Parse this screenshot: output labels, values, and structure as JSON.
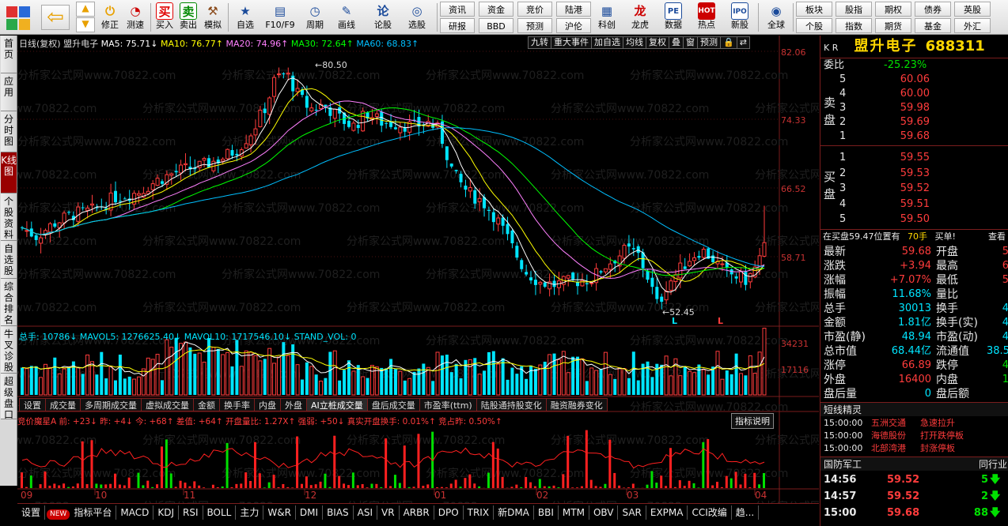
{
  "toolbar": {
    "buttons": [
      {
        "label": "买入",
        "icon": "买",
        "color": "#e00000"
      },
      {
        "label": "卖出",
        "icon": "卖",
        "color": "#008800"
      },
      {
        "label": "模拟",
        "icon": "🔨",
        "color": "#8a4a1a"
      },
      {
        "label": "自选",
        "icon": "★",
        "color": "#1a4a9a"
      },
      {
        "label": "F10/F9",
        "icon": "▤",
        "color": "#1a4a9a"
      },
      {
        "label": "周期",
        "icon": "◷",
        "color": "#1a4a9a"
      },
      {
        "label": "画线",
        "icon": "✎",
        "color": "#1a4a9a"
      },
      {
        "label": "论股",
        "icon": "论",
        "color": "#1a4a9a"
      },
      {
        "label": "选股",
        "icon": "◎",
        "color": "#1a4a9a"
      },
      {
        "label": "科创",
        "icon": "▦",
        "color": "#1a4a9a"
      },
      {
        "label": "龙虎",
        "icon": "龙",
        "color": "#c00000"
      },
      {
        "label": "数据",
        "icon": "PE",
        "color": "#1a4a9a"
      },
      {
        "label": "热点",
        "icon": "HOT",
        "color": "#c00000"
      },
      {
        "label": "新股",
        "icon": "IPO",
        "color": "#1a4a9a"
      },
      {
        "label": "全球",
        "icon": "◉",
        "color": "#1a4a9a"
      }
    ],
    "small_buttons": [
      {
        "label": "修正",
        "icon": "↑"
      },
      {
        "label": "测速",
        "icon": "⏻"
      },
      {
        "label": "测速",
        "icon": "◔"
      }
    ],
    "grid1": [
      [
        "资讯",
        "资金",
        "竞价",
        "陆港"
      ],
      [
        "研报",
        "BBD",
        "预测",
        "沪伦"
      ]
    ],
    "grid2": [
      [
        "板块",
        "股指",
        "期权",
        "债券",
        "英股"
      ],
      [
        "个股",
        "指数",
        "期货",
        "基金",
        "外汇"
      ]
    ]
  },
  "leftnav": [
    {
      "label": "首页",
      "active": false
    },
    {
      "label": "应用",
      "active": false
    },
    {
      "label": "分时图",
      "active": false
    },
    {
      "label": "K线图",
      "active": true
    },
    {
      "label": "个股资料",
      "active": false
    },
    {
      "label": "自选股",
      "active": false
    },
    {
      "label": "综合排名",
      "active": false
    },
    {
      "label": "牛叉诊股",
      "active": false
    },
    {
      "label": "超级盘口",
      "active": false
    }
  ],
  "chart": {
    "header": {
      "period": "日线(复权)",
      "name": "盟升电子",
      "ma5": "MA5: 75.71↓",
      "ma10": "MA10: 76.77↑",
      "ma20": "MA20: 74.96↑",
      "ma30": "MA30: 72.64↑",
      "ma60": "MA60: 68.83↑"
    },
    "header_buttons": [
      "九转",
      "重大事件",
      "加自选",
      "均线",
      "复权",
      "叠",
      "窗",
      "预测",
      "🔒",
      "⇄"
    ],
    "price_axis": [
      "82.06",
      "74.33",
      "66.52",
      "58.71"
    ],
    "max_label": "80.50",
    "min_label": "52.45",
    "markers": [
      "L",
      "L"
    ],
    "watermark": "分析家公式网www.70822.com",
    "volume": {
      "header": "总手: 10786↓ MAVOL5: 1276625.40↓ MAVOL10: 1717546.10↓ STAND_VOL: 0",
      "axis": [
        "34231",
        "17116"
      ]
    },
    "tabs": [
      "设置",
      "成交量",
      "多周期成交量",
      "虚拟成交量",
      "金额",
      "换手率",
      "内盘",
      "外盘",
      "AI立桩成交量",
      "盘后成交量",
      "市盈率(ttm)",
      "陆股通持股变化",
      "融资融券变化"
    ],
    "indicator": {
      "header": "竞价魔星A 前: +23↓ 昨: +4↓ 今: +68↑ 差值: +64↑ 开盘量比: 1.27X↑ 强弱: +50↓ 真实开盘换手: 0.01%↑ 竞占昨: 0.50%↑",
      "button": "指标说明"
    },
    "x_labels": [
      "09",
      "10",
      "11",
      "12",
      "01",
      "02",
      "03",
      "04"
    ]
  },
  "bottom_tabs": [
    "设置",
    "NEW",
    "指标平台",
    "MACD",
    "KDJ",
    "RSI",
    "BOLL",
    "主力",
    "W&R",
    "DMI",
    "BIAS",
    "ASI",
    "VR",
    "ARBR",
    "DPO",
    "TRIX",
    "新DMA",
    "BBI",
    "MTM",
    "OBV",
    "SAR",
    "EXPMA",
    "CCI改编",
    "趋..."
  ],
  "quote": {
    "market": "K R",
    "name": "盟升电子",
    "code": "688311",
    "weibi_label": "委比",
    "weibi": "-25.23%",
    "sell_label": "卖盘",
    "buy_label": "买盘",
    "sells": [
      {
        "level": "5",
        "price": "60.06"
      },
      {
        "level": "4",
        "price": "60.00"
      },
      {
        "level": "3",
        "price": "59.98"
      },
      {
        "level": "2",
        "price": "59.69"
      },
      {
        "level": "1",
        "price": "59.68"
      }
    ],
    "buys": [
      {
        "level": "1",
        "price": "59.55"
      },
      {
        "level": "2",
        "price": "59.53"
      },
      {
        "level": "3",
        "price": "59.52"
      },
      {
        "level": "4",
        "price": "59.51"
      },
      {
        "level": "5",
        "price": "59.50"
      }
    ],
    "notice": {
      "text": "在买盘59.47位置有",
      "qty": "70手",
      "action": "买单!",
      "more": "查看"
    },
    "stats_left": [
      {
        "k": "最新",
        "v": "59.68",
        "c": "red"
      },
      {
        "k": "涨跌",
        "v": "+3.94",
        "c": "red"
      },
      {
        "k": "涨幅",
        "v": "+7.07%",
        "c": "red"
      },
      {
        "k": "振幅",
        "v": "11.68%",
        "c": "cyan"
      },
      {
        "k": "总手",
        "v": "30013",
        "c": "cyan"
      },
      {
        "k": "金额",
        "v": "1.81亿",
        "c": "cyan"
      },
      {
        "k": "市盈(静)",
        "v": "48.94",
        "c": "cyan"
      },
      {
        "k": "总市值",
        "v": "68.44亿",
        "c": "cyan"
      },
      {
        "k": "涨停",
        "v": "66.89",
        "c": "red"
      },
      {
        "k": "外盘",
        "v": "16400",
        "c": "red"
      },
      {
        "k": "盘后量",
        "v": "0",
        "c": "cyan"
      }
    ],
    "stats_right": [
      {
        "k": "开盘",
        "v": "5",
        "c": "red"
      },
      {
        "k": "最高",
        "v": "6",
        "c": "red"
      },
      {
        "k": "最低",
        "v": "5",
        "c": "red"
      },
      {
        "k": "量比",
        "v": "",
        "c": "cyan"
      },
      {
        "k": "换手",
        "v": "4",
        "c": "cyan"
      },
      {
        "k": "换手(实)",
        "v": "4",
        "c": "cyan"
      },
      {
        "k": "市盈(动)",
        "v": "4",
        "c": "cyan"
      },
      {
        "k": "流通值",
        "v": "38.5",
        "c": "cyan"
      },
      {
        "k": "跌停",
        "v": "4",
        "c": "green"
      },
      {
        "k": "内盘",
        "v": "1",
        "c": "green"
      },
      {
        "k": "盘后额",
        "v": "",
        "c": "cyan"
      }
    ],
    "spirit": {
      "title": "短线精灵",
      "items": [
        {
          "time": "15:00:00",
          "name": "五洲交通",
          "event": "急速拉升"
        },
        {
          "time": "15:00:00",
          "name": "海德股份",
          "event": "打开跌停板"
        },
        {
          "time": "15:00:00",
          "name": "北部湾港",
          "event": "封涨停板"
        }
      ]
    },
    "sector": {
      "name": "国防军工",
      "right": "同行业"
    },
    "ticks": [
      {
        "time": "14:56",
        "price": "59.52",
        "qty": "5",
        "dir": "down"
      },
      {
        "time": "14:57",
        "price": "59.52",
        "qty": "2",
        "dir": "down"
      },
      {
        "time": "15:00",
        "price": "59.68",
        "qty": "88",
        "dir": "down"
      }
    ]
  },
  "colors": {
    "up": "#ff3c3c",
    "down": "#00e5ff",
    "ma5": "#ffffff",
    "ma10": "#ffff00",
    "ma20": "#ff80ff",
    "ma30": "#00ff00",
    "ma60": "#00bfff",
    "grid": "#7a1d1d"
  }
}
